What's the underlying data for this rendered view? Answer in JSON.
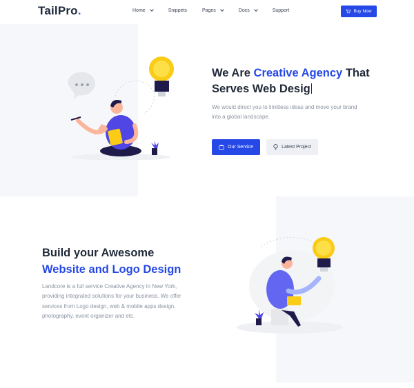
{
  "brand": {
    "name_main": "Tail",
    "name_accent": "Pro",
    "name_dot": "."
  },
  "nav": {
    "items": [
      {
        "label": "Home",
        "dropdown": true
      },
      {
        "label": "Snippets",
        "dropdown": false
      },
      {
        "label": "Pages",
        "dropdown": true
      },
      {
        "label": "Docs",
        "dropdown": true
      },
      {
        "label": "Support",
        "dropdown": false
      }
    ],
    "buy_label": "Buy Now"
  },
  "hero": {
    "title_prefix": "We Are ",
    "title_highlight": "Creative Agency",
    "title_suffix": " That",
    "title_line2": "Serves Web Desig",
    "description": "We would direct you to limitless ideas and move your brand into a global landscape.",
    "primary_button": "Our Service",
    "secondary_button": "Latest Project"
  },
  "feature": {
    "title_line1": "Build your Awesome",
    "title_line2": "Website and Logo Design",
    "description": "Landcore is a full service Creative Agency in New York, providing integrated solutions for your business. We offer services from Logo design, web & mobile apps design, photography, event organizer and etc."
  },
  "colors": {
    "accent": "#2548e6",
    "bulb": "#facc15",
    "text": "#1f2937",
    "muted": "#8b93a1",
    "panel": "#f6f7fb"
  },
  "icons": [
    "cart-icon",
    "chevron-down-icon",
    "briefcase-icon",
    "lightbulb-icon"
  ]
}
